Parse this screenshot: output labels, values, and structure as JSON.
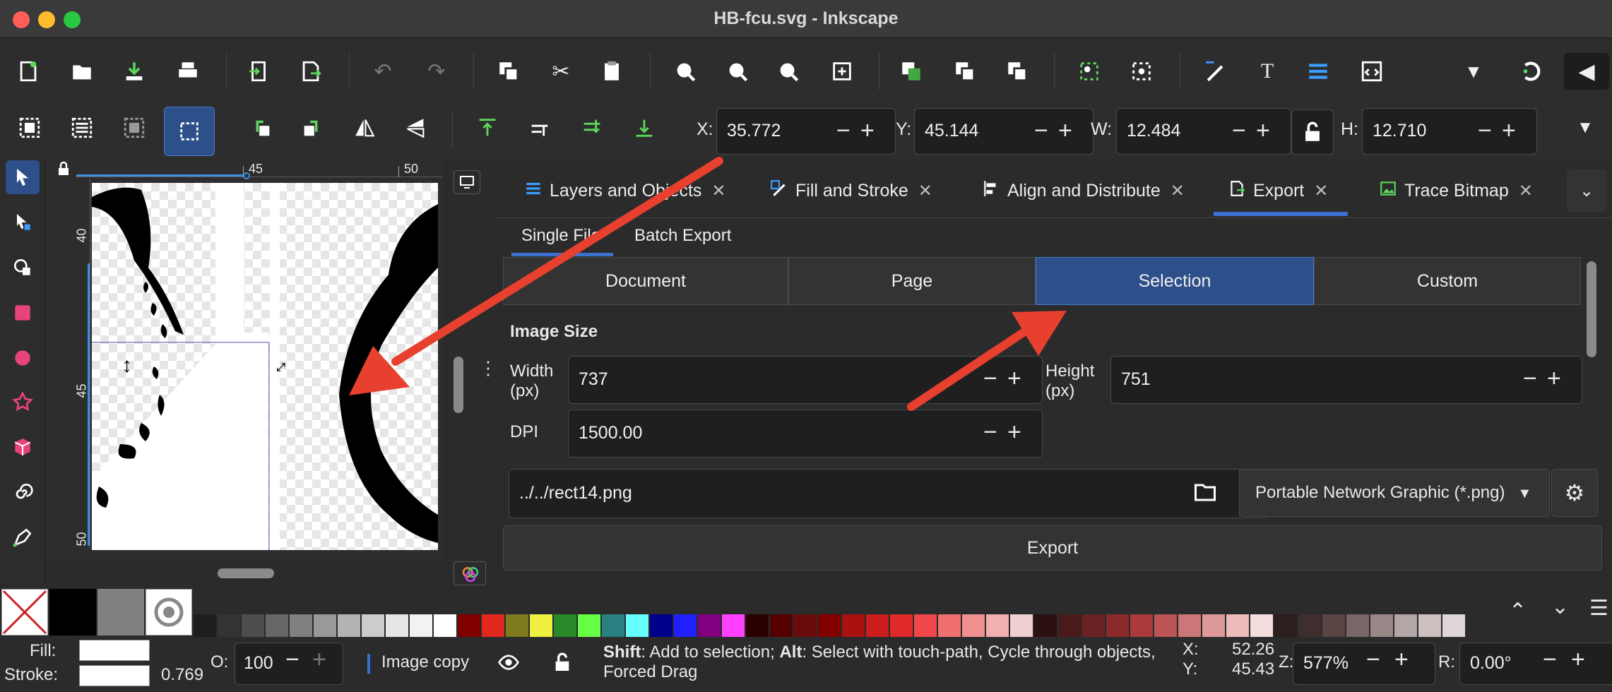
{
  "window": {
    "title": "HB-fcu.svg - Inkscape"
  },
  "coords": {
    "x_label": "X:",
    "x_value": "35.772",
    "y_label": "Y:",
    "y_value": "45.144",
    "w_label": "W:",
    "w_value": "12.484",
    "h_label": "H:",
    "h_value": "12.710"
  },
  "ruler": {
    "top_ticks": [
      "45",
      "50"
    ],
    "left_ticks": [
      "40",
      "45",
      "50"
    ]
  },
  "dialog": {
    "tabs": [
      {
        "label": "Layers and Objects",
        "icon": "layers-icon"
      },
      {
        "label": "Fill and Stroke",
        "icon": "fill-stroke-icon"
      },
      {
        "label": "Align and Distribute",
        "icon": "align-icon"
      },
      {
        "label": "Export",
        "icon": "export-icon"
      },
      {
        "label": "Trace Bitmap",
        "icon": "trace-bitmap-icon"
      }
    ],
    "subtabs": [
      "Single File",
      "Batch Export"
    ],
    "areas": [
      "Document",
      "Page",
      "Selection",
      "Custom"
    ],
    "image_size_title": "Image Size",
    "width_label": "Width\n(px)",
    "width_value": "737",
    "height_label": "Height\n(px)",
    "height_value": "751",
    "dpi_label": "DPI",
    "dpi_value": "1500.00",
    "filename": "../../rect14.png",
    "format": "Portable Network Graphic (*.png)",
    "export_label": "Export"
  },
  "status": {
    "fill_label": "Fill:",
    "stroke_label": "Stroke:",
    "stroke_width": "0.769",
    "opacity_label": "O:",
    "opacity_value": "100",
    "layer": "Image copy",
    "hint_bold1": "Shift",
    "hint1": ": Add to selection; ",
    "hint_bold2": "Alt",
    "hint2": ": Select with touch-path, Cycle through objects, Forced Drag",
    "cursor_x_label": "X:",
    "cursor_x": "52.26",
    "cursor_y_label": "Y:",
    "cursor_y": "45.43",
    "zoom_label": "Z:",
    "zoom_value": "577%",
    "rotation_label": "R:",
    "rotation_value": "0.00°"
  },
  "colors": {
    "accent": "#2d4f8a",
    "active_tab": "#3b6fd0",
    "arrow": "#e8402e"
  }
}
